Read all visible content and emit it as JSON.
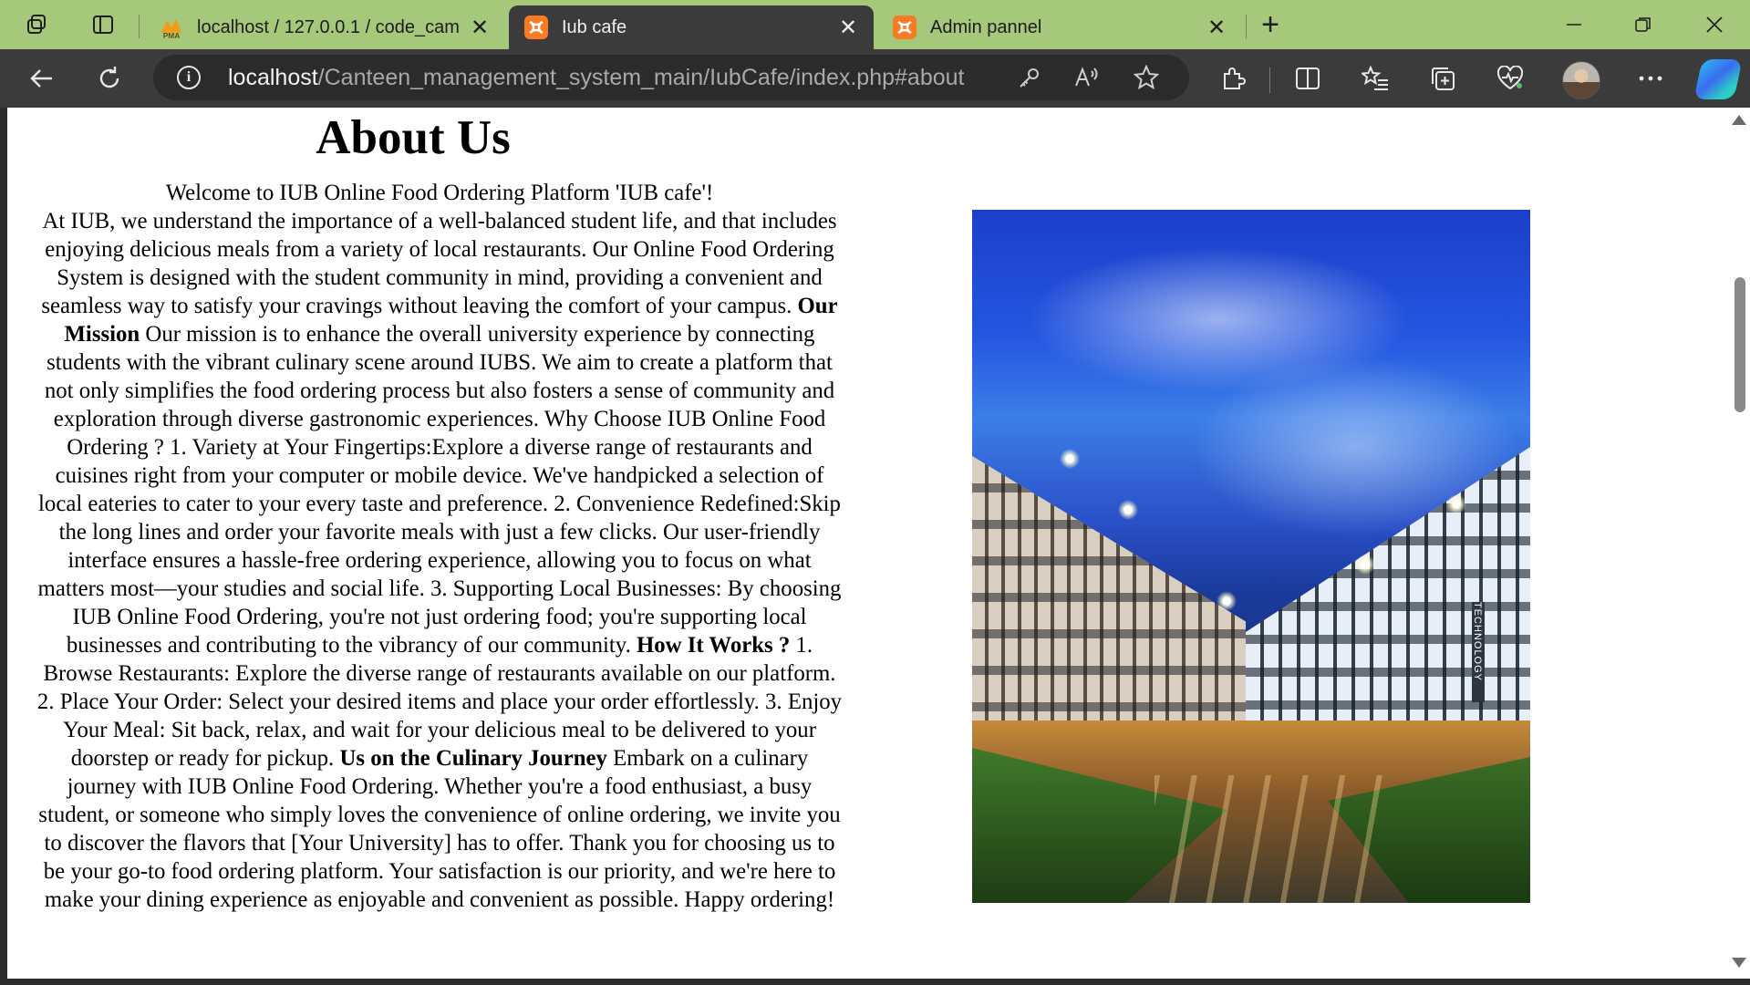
{
  "browser": {
    "tabs": [
      {
        "title": "localhost / 127.0.0.1 / code_camp",
        "favicon": "phpmyadmin-icon",
        "active": false
      },
      {
        "title": "Iub cafe",
        "favicon": "xampp-icon",
        "active": true
      },
      {
        "title": "Admin pannel",
        "favicon": "xampp-icon",
        "active": false
      }
    ],
    "favicon_label": "PMA",
    "url_host": "localhost",
    "url_path": "/Canteen_management_system_main/IubCafe/index.php#about",
    "accent_color": "#a6c87a"
  },
  "page": {
    "heading": "About Us",
    "intro": "Welcome to IUB Online Food Ordering Platform 'IUB cafe'!",
    "paragraph_1": "At IUB, we understand the importance of a well-balanced student life, and that includes enjoying delicious meals from a variety of local restaurants. Our Online Food Ordering System is designed with the student community in mind, providing a convenient and seamless way to satisfy your cravings without leaving the comfort of your campus.",
    "mission_heading": "Our Mission",
    "mission_text": "Our mission is to enhance the overall university experience by connecting students with the vibrant culinary scene around IUBS. We aim to create a platform that not only simplifies the food ordering process but also fosters a sense of community and exploration through diverse gastronomic experiences. Why Choose IUB Online Food Ordering ? 1. Variety at Your Fingertips:Explore a diverse range of restaurants and cuisines right from your computer or mobile device. We've handpicked a selection of local eateries to cater to your every taste and preference. 2. Convenience Redefined:Skip the long lines and order your favorite meals with just a few clicks. Our user-friendly interface ensures a hassle-free ordering experience, allowing you to focus on what matters most—your studies and social life. 3. Supporting Local Businesses: By choosing IUB Online Food Ordering, you're not just ordering food; you're supporting local businesses and contributing to the vibrancy of our community.",
    "how_heading": "How It Works ?",
    "how_text": "1. Browse Restaurants: Explore the diverse range of restaurants available on our platform. 2. Place Your Order: Select your desired items and place your order effortlessly. 3. Enjoy Your Meal: Sit back, relax, and wait for your delicious meal to be delivered to your doorstep or ready for pickup.",
    "journey_heading": "Us on the Culinary Journey",
    "journey_text": "Embark on a culinary journey with IUB Online Food Ordering. Whether you're a food enthusiast, a busy student, or someone who simply loves the convenience of online ordering, we invite you to discover the flavors that [Your University] has to offer. Thank you for choosing us to be your go-to food ordering platform. Your satisfaction is our priority, and we're here to make your dining experience as enjoyable and convenient as possible. Happy ordering!",
    "image_sign_text": "TECHNOLOGY"
  }
}
